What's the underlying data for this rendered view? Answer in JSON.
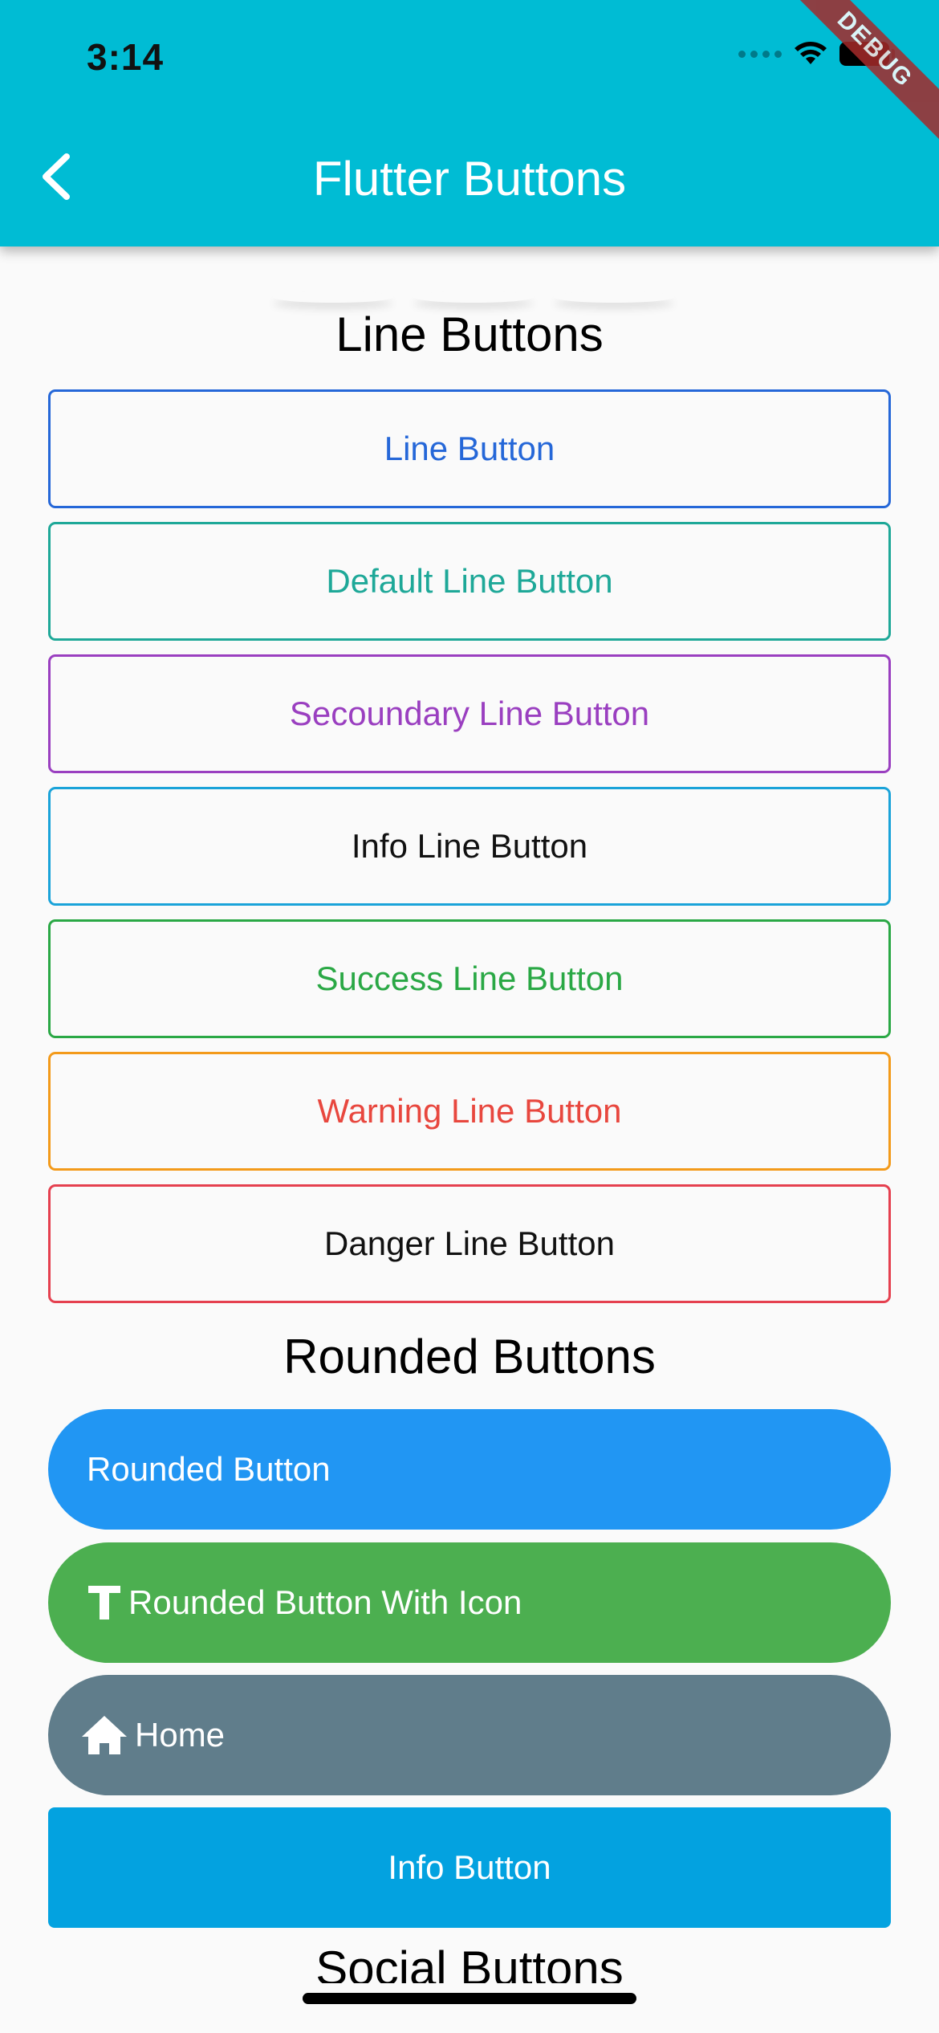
{
  "status_bar": {
    "time": "3:14",
    "debug_label": "DEBUG"
  },
  "app_bar": {
    "title": "Flutter Buttons",
    "background": "#00bcd4",
    "back_icon": "chevron-left-icon"
  },
  "line_section": {
    "title": "Line Buttons",
    "buttons": [
      {
        "label": "Line Button",
        "border": "#2567d8",
        "text_color": "#2567d8"
      },
      {
        "label": "Default Line Button",
        "border": "#1ea898",
        "text_color": "#1ea898"
      },
      {
        "label": "Secoundary Line Button",
        "border": "#9a3fc0",
        "text_color": "#9a3fc0"
      },
      {
        "label": "Info Line Button",
        "border": "#1aa3d9",
        "text_color": "#111111"
      },
      {
        "label": "Success Line Button",
        "border": "#2aa845",
        "text_color": "#2aa845"
      },
      {
        "label": "Warning Line Button",
        "border": "#f39a1a",
        "text_color": "#e8473e"
      },
      {
        "label": "Danger Line Button",
        "border": "#e5404f",
        "text_color": "#111111"
      }
    ]
  },
  "rounded_section": {
    "title": "Rounded Buttons",
    "buttons": [
      {
        "label": "Rounded Button",
        "background": "#2196f3",
        "icon": null
      },
      {
        "label": "Rounded Button With Icon",
        "background": "#4caf50",
        "icon": "text-t-icon"
      },
      {
        "label": "Home",
        "background": "#607d8b",
        "icon": "home-icon"
      }
    ],
    "info_button": {
      "label": "Info Button",
      "background": "#03a2e0"
    }
  },
  "social_section": {
    "title": "Social Buttons"
  }
}
